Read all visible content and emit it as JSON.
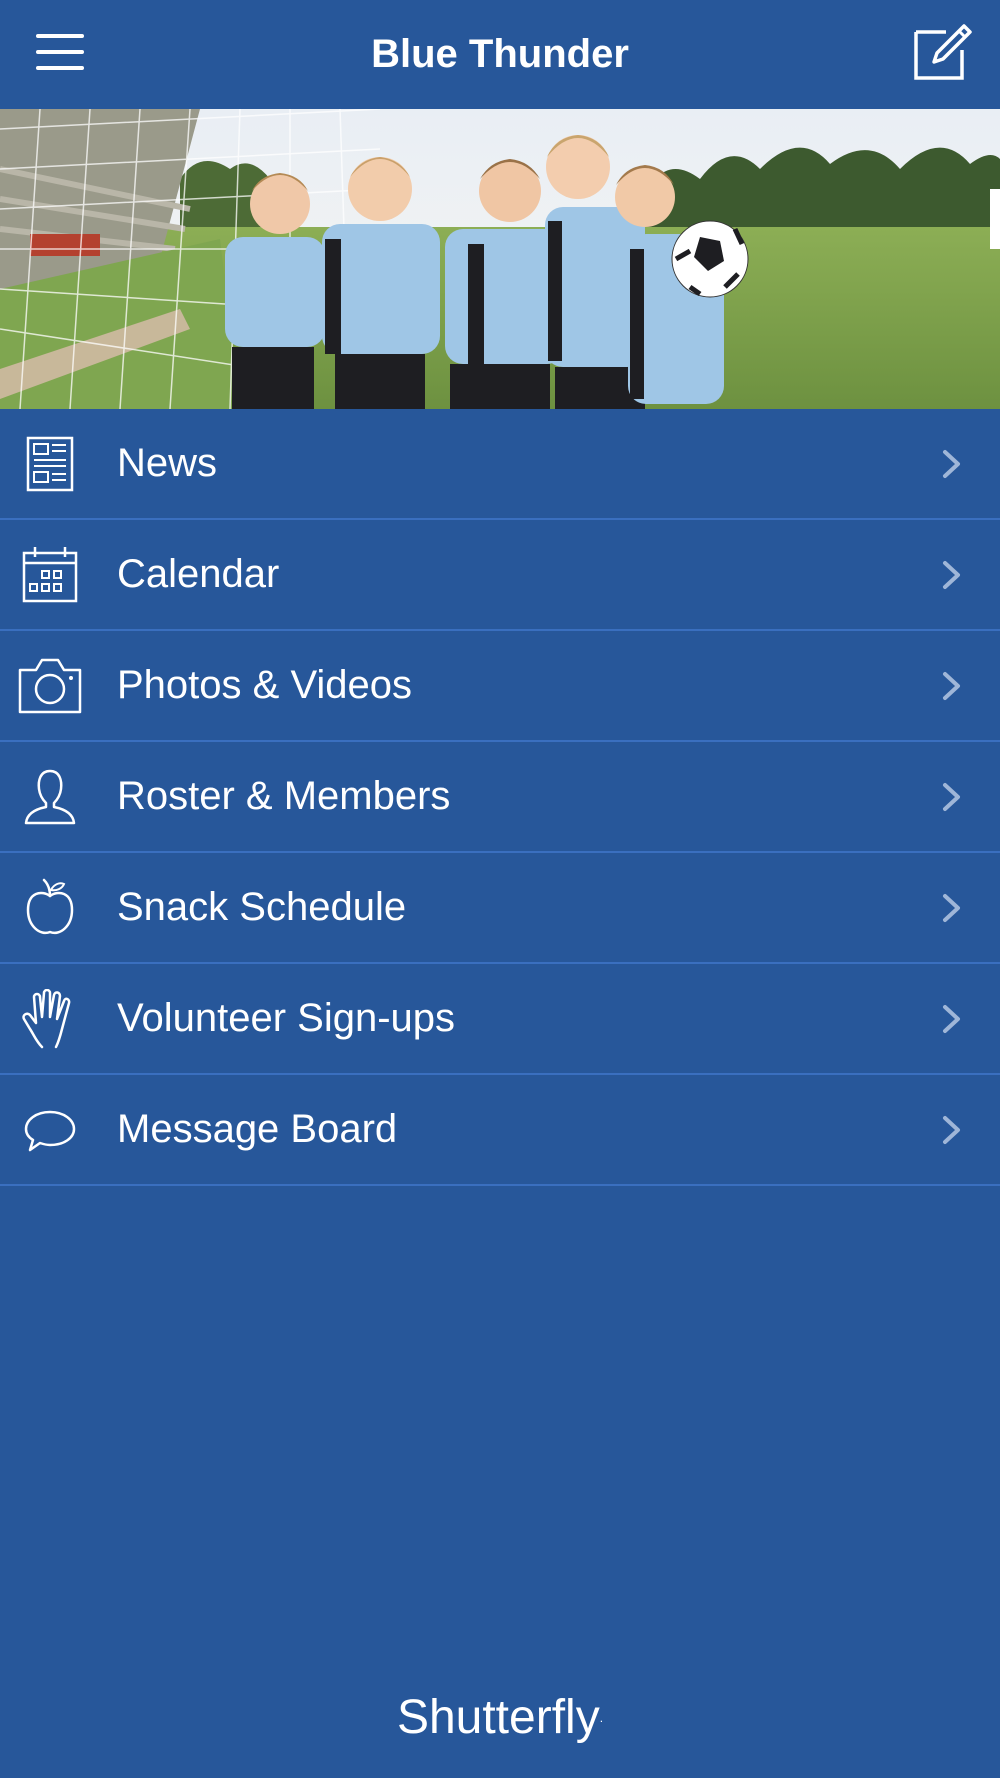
{
  "header": {
    "title": "Blue Thunder",
    "menu_icon": "hamburger-menu-icon",
    "compose_icon": "compose-edit-icon"
  },
  "hero": {
    "image": "team-photo-kids-soccer"
  },
  "menu": {
    "items": [
      {
        "label": "News",
        "icon": "newspaper-icon"
      },
      {
        "label": "Calendar",
        "icon": "calendar-icon"
      },
      {
        "label": "Photos & Videos",
        "icon": "camera-icon"
      },
      {
        "label": "Roster & Members",
        "icon": "person-icon"
      },
      {
        "label": "Snack Schedule",
        "icon": "apple-icon"
      },
      {
        "label": "Volunteer Sign-ups",
        "icon": "raised-hand-icon"
      },
      {
        "label": "Message Board",
        "icon": "speech-bubble-icon"
      }
    ],
    "chevron_icon": "chevron-right-icon"
  },
  "footer": {
    "brand": "Shutterfly",
    "trademark": "."
  },
  "colors": {
    "background": "#27579a",
    "divider": "#3a6fbf",
    "chevron": "#9fb6d8",
    "text": "#ffffff"
  }
}
